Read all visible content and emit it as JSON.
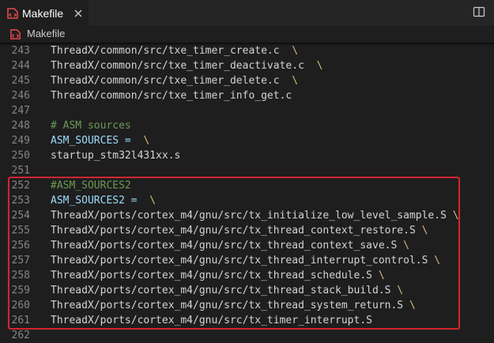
{
  "tab": {
    "label": "Makefile",
    "file_icon": "makefile-icon",
    "close_icon": "close-icon"
  },
  "toolbar": {
    "split_icon": "split-editor-icon"
  },
  "breadcrumb": {
    "label": "Makefile",
    "icon": "makefile-icon"
  },
  "colors": {
    "accent_icon": "#e5484d",
    "highlight_border": "#d0262e",
    "line_continuation": "#d7ba7d",
    "variable": "#9cdcfe",
    "comment": "#6a9955",
    "text": "#d4d4d4"
  },
  "editor": {
    "lines": [
      {
        "num": "243",
        "text": "ThreadX/common/src/txe_timer_create.c",
        "cont": "\\",
        "kind": "path"
      },
      {
        "num": "244",
        "text": "ThreadX/common/src/txe_timer_deactivate.c",
        "cont": "\\",
        "kind": "path"
      },
      {
        "num": "245",
        "text": "ThreadX/common/src/txe_timer_delete.c",
        "cont": "\\",
        "kind": "path"
      },
      {
        "num": "246",
        "text": "ThreadX/common/src/txe_timer_info_get.c",
        "cont": "",
        "kind": "path"
      },
      {
        "num": "247",
        "text": "",
        "cont": "",
        "kind": "blank"
      },
      {
        "num": "248",
        "text": "# ASM sources",
        "cont": "",
        "kind": "comment"
      },
      {
        "num": "249",
        "text": "ASM_SOURCES =",
        "cont": "\\",
        "kind": "var"
      },
      {
        "num": "250",
        "text": "startup_stm32l431xx.s",
        "cont": "",
        "kind": "path"
      },
      {
        "num": "251",
        "text": "",
        "cont": "",
        "kind": "blank"
      },
      {
        "num": "252",
        "text": "#ASM_SOURCES2",
        "cont": "",
        "kind": "comment"
      },
      {
        "num": "253",
        "text": "ASM_SOURCES2 =",
        "cont": "\\",
        "kind": "var"
      },
      {
        "num": "254",
        "text": "ThreadX/ports/cortex_m4/gnu/src/tx_initialize_low_level_sample.S",
        "cont": "\\",
        "kind": "path"
      },
      {
        "num": "255",
        "text": "ThreadX/ports/cortex_m4/gnu/src/tx_thread_context_restore.S",
        "cont": "\\",
        "kind": "path"
      },
      {
        "num": "256",
        "text": "ThreadX/ports/cortex_m4/gnu/src/tx_thread_context_save.S",
        "cont": "\\",
        "kind": "path"
      },
      {
        "num": "257",
        "text": "ThreadX/ports/cortex_m4/gnu/src/tx_thread_interrupt_control.S",
        "cont": "\\",
        "kind": "path"
      },
      {
        "num": "258",
        "text": "ThreadX/ports/cortex_m4/gnu/src/tx_thread_schedule.S",
        "cont": "\\",
        "kind": "path"
      },
      {
        "num": "259",
        "text": "ThreadX/ports/cortex_m4/gnu/src/tx_thread_stack_build.S",
        "cont": "\\",
        "kind": "path"
      },
      {
        "num": "260",
        "text": "ThreadX/ports/cortex_m4/gnu/src/tx_thread_system_return.S",
        "cont": "\\",
        "kind": "path"
      },
      {
        "num": "261",
        "text": "ThreadX/ports/cortex_m4/gnu/src/tx_timer_interrupt.S",
        "cont": "",
        "kind": "path"
      },
      {
        "num": "262",
        "text": "",
        "cont": "",
        "kind": "blank"
      }
    ]
  }
}
